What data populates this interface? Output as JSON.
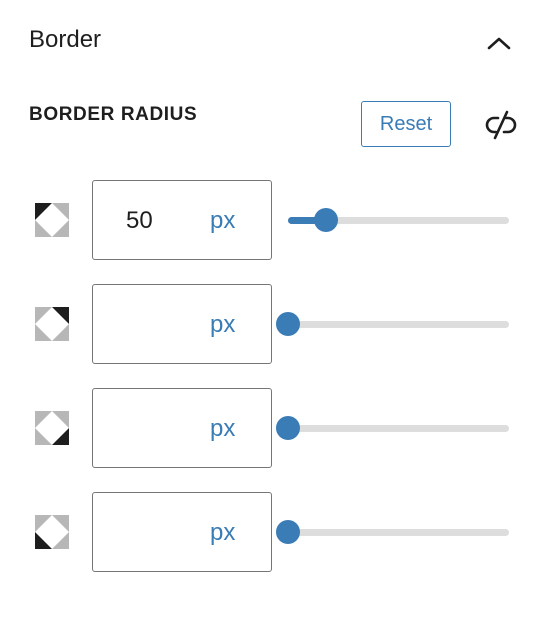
{
  "panel": {
    "title": "Border",
    "collapse_icon": "chevron-up-icon"
  },
  "border_radius": {
    "label": "BORDER RADIUS",
    "reset_label": "Reset",
    "unlink_icon": "link-off-icon",
    "accent_color": "#3a7cb6",
    "corners": [
      {
        "corner": "top-left",
        "icon": "corner-top-left-icon",
        "value": "50",
        "unit": "px",
        "slider_fraction": 0.17
      },
      {
        "corner": "top-right",
        "icon": "corner-top-right-icon",
        "value": "",
        "unit": "px",
        "slider_fraction": 0
      },
      {
        "corner": "bottom-right",
        "icon": "corner-bottom-right-icon",
        "value": "",
        "unit": "px",
        "slider_fraction": 0
      },
      {
        "corner": "bottom-left",
        "icon": "corner-bottom-left-icon",
        "value": "",
        "unit": "px",
        "slider_fraction": 0
      }
    ]
  }
}
